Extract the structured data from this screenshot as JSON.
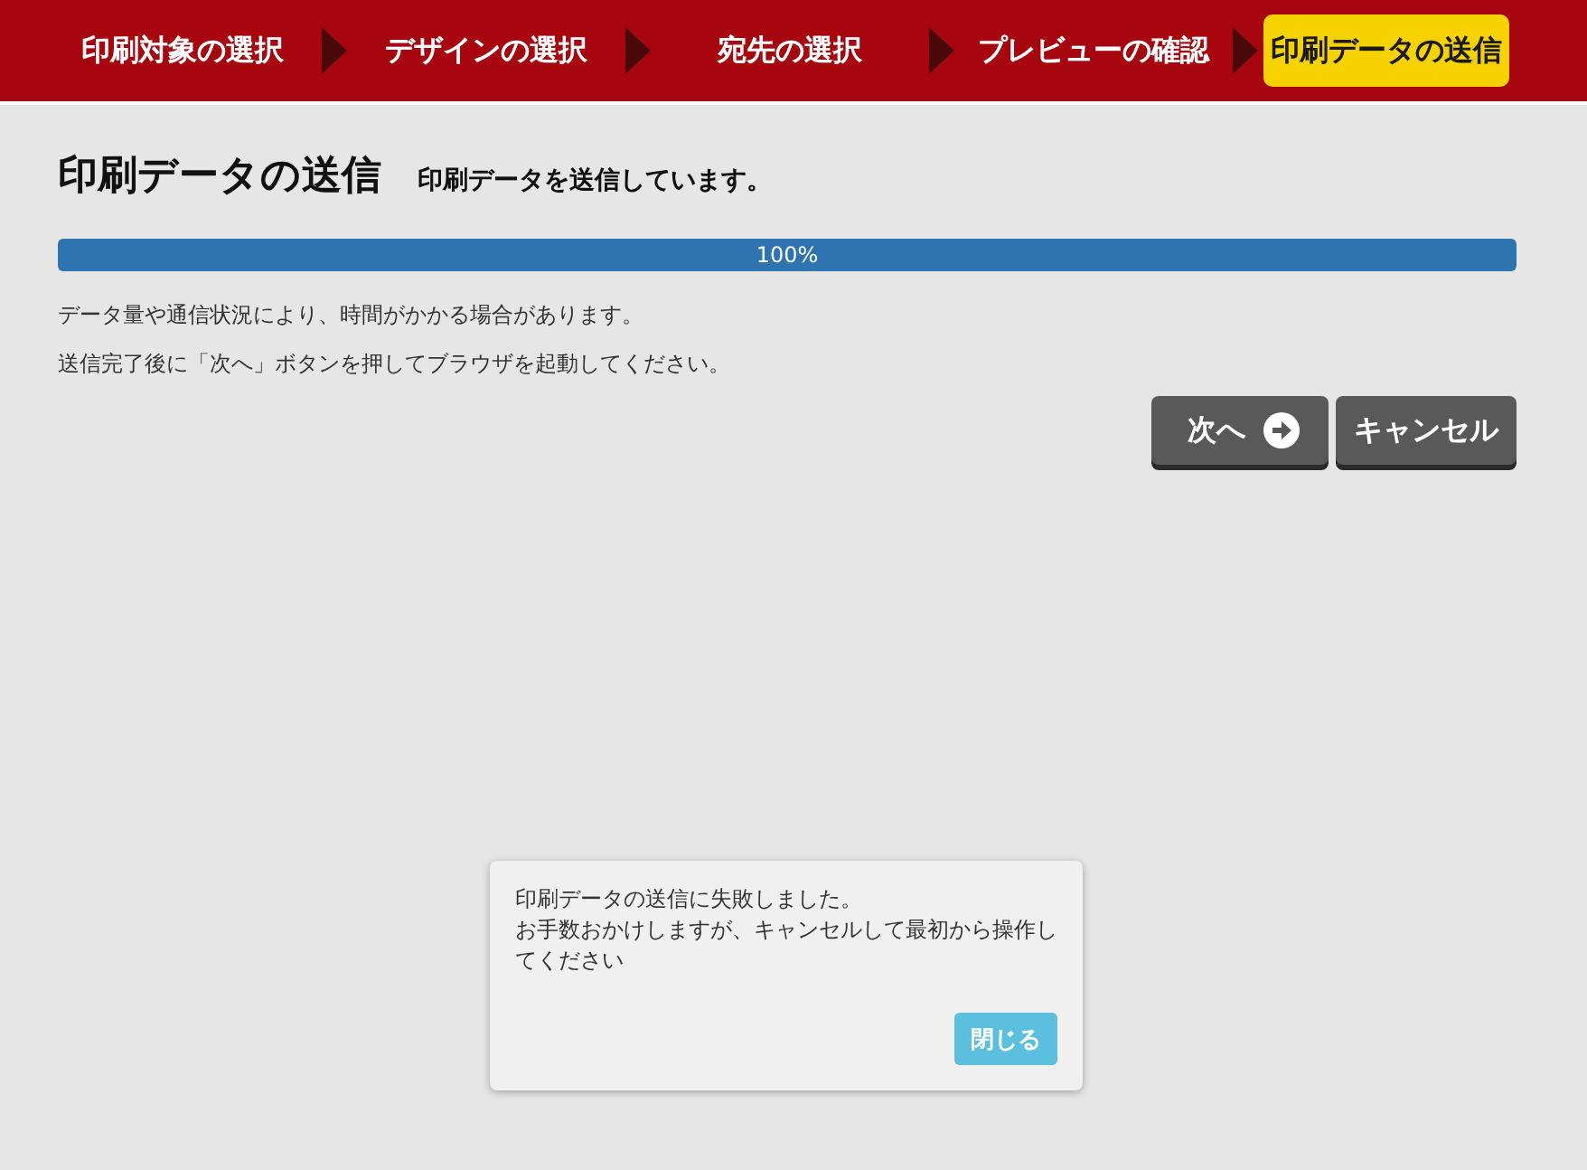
{
  "steps": [
    {
      "label": "印刷対象の選択",
      "selected": false
    },
    {
      "label": "デザインの選択",
      "selected": false
    },
    {
      "label": "宛先の選択",
      "selected": false
    },
    {
      "label": "プレビューの確認",
      "selected": false
    },
    {
      "label": "印刷データの送信",
      "selected": true
    }
  ],
  "title": "印刷データの送信",
  "subtitle": "印刷データを送信しています。",
  "progress": {
    "level": 1,
    "reading": "100%"
  },
  "notes": [
    "データ量や通信状況により、時間がかかる場合があります。",
    "送信完了後に「次へ」ボタンを押してブラウザを起動してください。"
  ],
  "buttons": [
    {
      "label": "次へ",
      "kind": "next"
    },
    {
      "label": "キャンセル",
      "kind": "plain"
    }
  ],
  "dialog": {
    "lines": [
      "印刷データの送信に失敗しました。",
      "お手数おかけしますが、キャンセルして最初から操作してください"
    ],
    "button": "閉じる"
  }
}
